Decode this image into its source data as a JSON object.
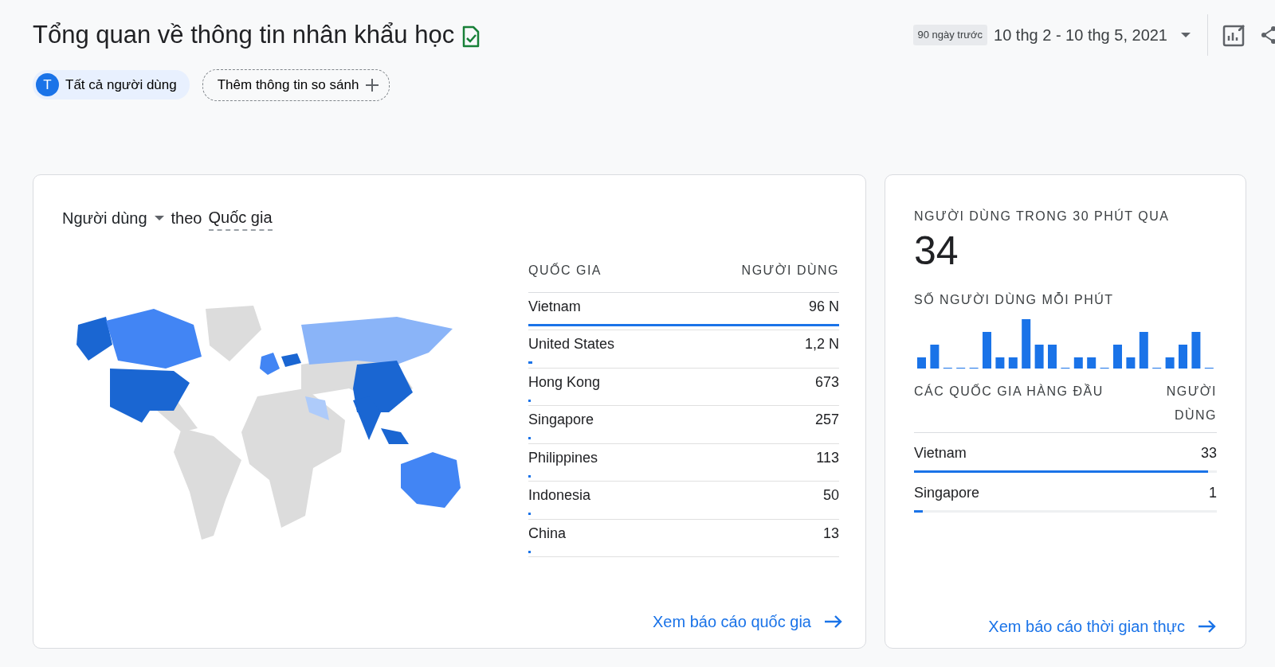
{
  "header": {
    "title": "Tổng quan về thông tin nhân khẩu học",
    "range_badge": "90 ngày trước",
    "date_range": "10 thg 2 - 10 thg 5, 2021"
  },
  "chips": [
    {
      "kind": "segment",
      "avatar": "T",
      "label": "Tất cả người dùng"
    },
    {
      "kind": "add",
      "label": "Thêm thông tin so sánh"
    }
  ],
  "country_card": {
    "metric": "Người dùng",
    "by": "theo",
    "dimension": "Quốc gia",
    "columns": [
      "QUỐC GIA",
      "NGƯỜI DÙNG"
    ],
    "rows": [
      {
        "country": "Vietnam",
        "users": "96 N",
        "level": 1.0
      },
      {
        "country": "United States",
        "users": "1,2 N",
        "level": 0.0125
      },
      {
        "country": "Hong Kong",
        "users": "673",
        "level": 0.007
      },
      {
        "country": "Singapore",
        "users": "257",
        "level": 0.003
      },
      {
        "country": "Philippines",
        "users": "113",
        "level": 0.001
      },
      {
        "country": "Indonesia",
        "users": "50",
        "level": 0.0005
      },
      {
        "country": "China",
        "users": "13",
        "level": 0.0001
      }
    ],
    "link": "Xem báo cáo quốc gia"
  },
  "realtime_card": {
    "title": "NGƯỜI DÙNG TRONG 30 PHÚT QUA",
    "count": "34",
    "per_minute_label": "SỐ NGƯỜI DÙNG MỖI PHÚT",
    "columns": [
      "CÁC QUỐC GIA HÀNG ĐẦU",
      "NGƯỜI DÙNG"
    ],
    "rows": [
      {
        "country": "Vietnam",
        "users": "33",
        "level": 0.97
      },
      {
        "country": "Singapore",
        "users": "1",
        "level": 0.03
      }
    ],
    "link": "Xem báo cáo thời gian thực"
  }
}
